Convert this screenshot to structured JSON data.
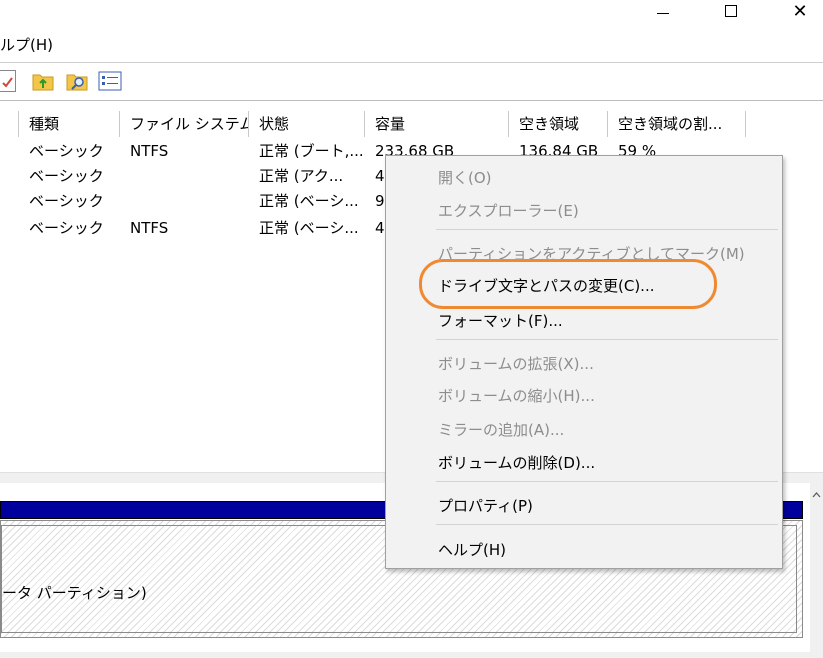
{
  "window": {
    "controls": [
      "minimize",
      "maximize",
      "close"
    ],
    "close_glyph": "✕"
  },
  "menubar": {
    "help_label": "ルプ(H)"
  },
  "toolbar": {
    "icons": [
      "check-document-icon",
      "up-folder-icon",
      "search-folder-icon",
      "properties-list-icon"
    ]
  },
  "list": {
    "columns": [
      "種類",
      "ファイル システム",
      "状態",
      "容量",
      "空き領域",
      "空き領域の割..."
    ],
    "rows": [
      {
        "type": "ベーシック",
        "fs": "NTFS",
        "status": "正常 (ブート,...",
        "capacity": "233.68 GB",
        "free": "136.84 GB",
        "pct": "59 %"
      },
      {
        "type": "ベーシック",
        "fs": "",
        "status": "正常 (アク...",
        "capacity": "4",
        "free": "",
        "pct": ""
      },
      {
        "type": "ベーシック",
        "fs": "",
        "status": "正常 (ベーシ...",
        "capacity": "9",
        "free": "",
        "pct": ""
      },
      {
        "type": "ベーシック",
        "fs": "NTFS",
        "status": "正常 (ベーシ...",
        "capacity": "4",
        "free": "",
        "pct": ""
      }
    ]
  },
  "lower": {
    "partition_label": "ータ パーティション)"
  },
  "context_menu": {
    "items": [
      {
        "label": "開く(O)",
        "enabled": false
      },
      {
        "label": "エクスプローラー(E)",
        "enabled": false
      },
      {
        "label": "パーティションをアクティブとしてマーク(M)",
        "enabled": false
      },
      {
        "label": "ドライブ文字とパスの変更(C)...",
        "enabled": true
      },
      {
        "label": "フォーマット(F)...",
        "enabled": true
      },
      {
        "label": "ボリュームの拡張(X)...",
        "enabled": false
      },
      {
        "label": "ボリュームの縮小(H)...",
        "enabled": false
      },
      {
        "label": "ミラーの追加(A)...",
        "enabled": false
      },
      {
        "label": "ボリュームの削除(D)...",
        "enabled": true
      },
      {
        "label": "プロパティ(P)",
        "enabled": true
      },
      {
        "label": "ヘルプ(H)",
        "enabled": true
      }
    ],
    "highlight_color": "#f08a32"
  },
  "colors": {
    "disk_bar": "#00009c",
    "menu_bg": "#f2f2f2",
    "disabled_text": "#8d8d8d"
  }
}
